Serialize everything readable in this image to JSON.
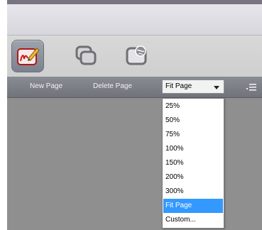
{
  "toolbar": {
    "tools": [
      {
        "icon": "pen-icon",
        "active": true
      },
      {
        "icon": "copy-windows-icon",
        "active": false
      },
      {
        "icon": "globe-window-icon",
        "active": false
      }
    ]
  },
  "commands": {
    "new_page": "New Page",
    "delete_page": "Delete Page"
  },
  "zoom": {
    "selected": "Fit Page",
    "options": [
      "25%",
      "50%",
      "75%",
      "100%",
      "150%",
      "200%",
      "300%",
      "Fit Page",
      "Custom..."
    ]
  },
  "colors": {
    "accent": "#3399ff",
    "command_bar": "#7d8087",
    "canvas": "#8f8f8f"
  }
}
